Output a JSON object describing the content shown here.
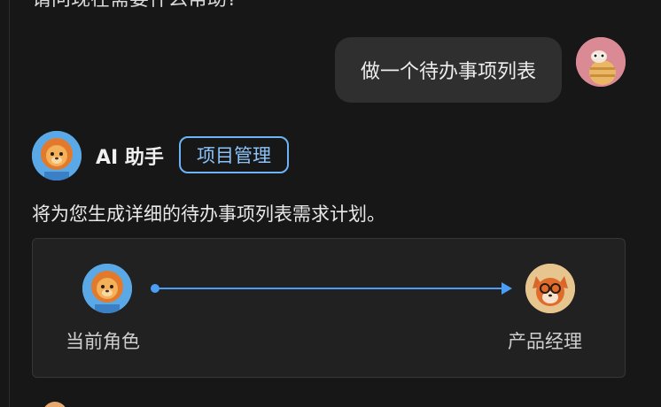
{
  "conversation": {
    "previous_message_tail": "请问现在需要什么帮助?",
    "user_message": {
      "text": "做一个待办事项列表",
      "avatar_icon": "bear-avatar-icon"
    },
    "assistant": {
      "name": "AI 助手",
      "tag": "项目管理",
      "avatar_icon": "lion-avatar-icon",
      "message": "将为您生成详细的待办事项列表需求计划。"
    },
    "handoff": {
      "from_label": "当前角色",
      "from_avatar_icon": "lion-avatar-icon",
      "to_label": "产品经理",
      "to_avatar_icon": "fox-avatar-icon",
      "arrow_color": "#4A9EF5"
    }
  },
  "colors": {
    "background": "#171717",
    "bubble": "#2F2F2F",
    "accent": "#6EB3F7",
    "card": "#212121"
  }
}
